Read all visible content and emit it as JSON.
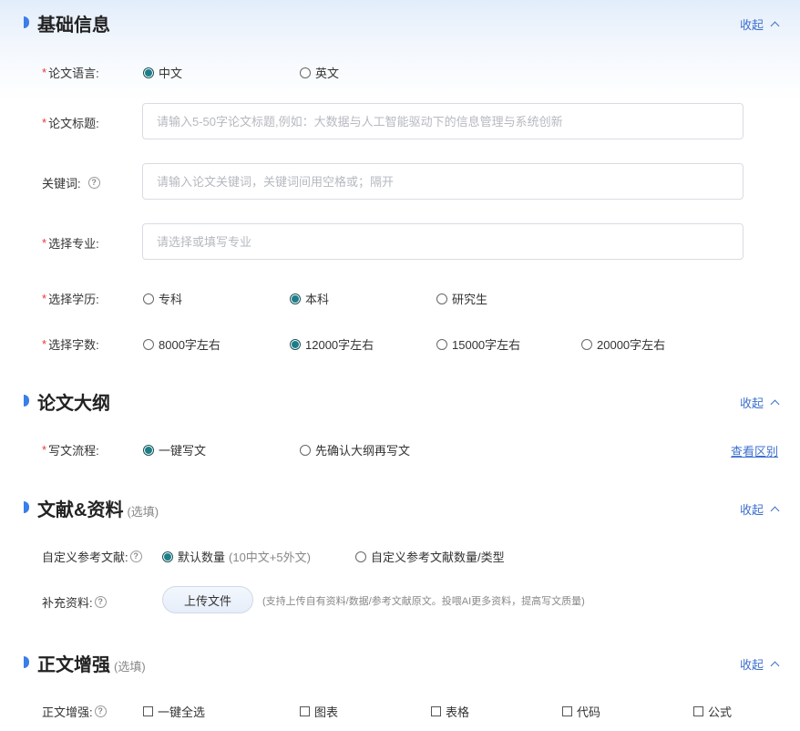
{
  "sections": {
    "basic": {
      "title": "基础信息",
      "collapse": "收起"
    },
    "outline": {
      "title": "论文大纲",
      "collapse": "收起"
    },
    "refs": {
      "title": "文献&资料",
      "note": "(选填)",
      "collapse": "收起"
    },
    "body": {
      "title": "正文增强",
      "note": "(选填)",
      "collapse": "收起"
    }
  },
  "language": {
    "label": "论文语言:",
    "options": [
      "中文",
      "英文"
    ],
    "selected": "中文"
  },
  "paper_title": {
    "label": "论文标题:",
    "placeholder": "请输入5-50字论文标题,例如：大数据与人工智能驱动下的信息管理与系统创新",
    "value": ""
  },
  "keywords": {
    "label": "关键词:",
    "placeholder": "请输入论文关键词，关键词间用空格或；隔开",
    "value": ""
  },
  "major": {
    "label": "选择专业:",
    "placeholder": "请选择或填写专业",
    "value": ""
  },
  "degree": {
    "label": "选择学历:",
    "options": [
      "专科",
      "本科",
      "研究生"
    ],
    "selected": "本科"
  },
  "word_count": {
    "label": "选择字数:",
    "options": [
      "8000字左右",
      "12000字左右",
      "15000字左右",
      "20000字左右"
    ],
    "selected": "12000字左右"
  },
  "flow": {
    "label": "写文流程:",
    "options": [
      "一键写文",
      "先确认大纲再写文"
    ],
    "selected": "一键写文",
    "link": "查看区别"
  },
  "custom_refs": {
    "label": "自定义参考文献:",
    "options": [
      "默认数量",
      "自定义参考文献数量/类型"
    ],
    "default_hint": "(10中文+5外文)",
    "selected": "默认数量"
  },
  "supplement": {
    "label": "补充资料:",
    "button": "上传文件",
    "hint": "(支持上传自有资料/数据/参考文献原文。投喂AI更多资料，提高写文质量)"
  },
  "enhance": {
    "label": "正文增强:",
    "options": [
      "一键全选",
      "图表",
      "表格",
      "代码",
      "公式"
    ]
  },
  "colors": {
    "accent": "#3d6fcf",
    "required": "#e53935",
    "radio_checked": "#1a7f8a",
    "marker": "#3a7ee8"
  }
}
